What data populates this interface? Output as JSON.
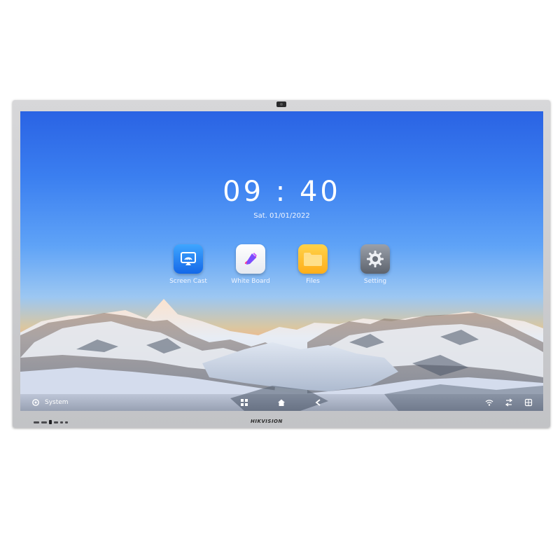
{
  "device": {
    "brand": "HIKVISION",
    "bezel_color": "#cbccce"
  },
  "home": {
    "time": "09 : 40",
    "date": "Sat. 01/01/2022",
    "apps": [
      {
        "label": "Screen Cast",
        "icon": "screen-cast-icon",
        "color": "#1f7cf0"
      },
      {
        "label": "White Board",
        "icon": "pen-icon",
        "color": "#ffffff"
      },
      {
        "label": "Files",
        "icon": "folder-icon",
        "color": "#ffbd2e"
      },
      {
        "label": "Setting",
        "icon": "gear-icon",
        "color": "#7a808a"
      }
    ]
  },
  "taskbar": {
    "system_label": "System",
    "icons": [
      "apps-icon",
      "home-icon",
      "back-icon",
      "wifi-icon",
      "input-source-icon",
      "window-icon"
    ]
  }
}
